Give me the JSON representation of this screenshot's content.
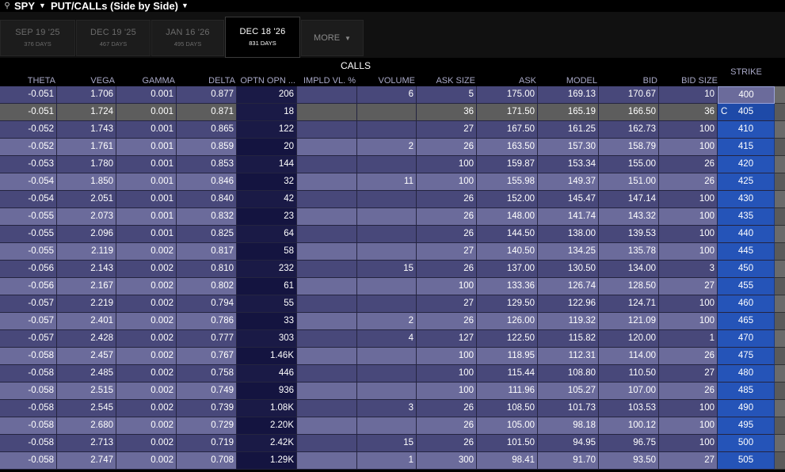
{
  "title_bar": {
    "symbol": "SPY",
    "view": "PUT/CALLs (Side by Side)"
  },
  "tabs": [
    {
      "label": "SEP 19 '25",
      "days": "376 DAYS",
      "active": false
    },
    {
      "label": "DEC 19 '25",
      "days": "467 DAYS",
      "active": false
    },
    {
      "label": "JAN 16 '26",
      "days": "495 DAYS",
      "active": false
    },
    {
      "label": "DEC 18 '26",
      "days": "831 DAYS",
      "active": true
    }
  ],
  "more_tab": {
    "label": "MORE"
  },
  "section_label": "CALLS",
  "strike_header": "STRIKE",
  "columns": [
    "THETA",
    "VEGA",
    "GAMMA",
    "DELTA",
    "OPTN OPN ...",
    "IMPLD VL. %",
    "VOLUME",
    "ASK SIZE",
    "ASK",
    "MODEL",
    "BID",
    "BID SIZE"
  ],
  "rows": [
    {
      "theta": "-0.051",
      "vega": "1.706",
      "gamma": "0.001",
      "delta": "0.877",
      "oi": "206",
      "iv": "",
      "volume": "6",
      "ask_size": "5",
      "ask": "175.00",
      "model": "169.13",
      "bid": "170.67",
      "bid_size": "10",
      "flag": "",
      "strike": "400"
    },
    {
      "theta": "-0.051",
      "vega": "1.724",
      "gamma": "0.001",
      "delta": "0.871",
      "oi": "18",
      "iv": "",
      "volume": "",
      "ask_size": "36",
      "ask": "171.50",
      "model": "165.19",
      "bid": "166.50",
      "bid_size": "36",
      "flag": "C",
      "strike": "405"
    },
    {
      "theta": "-0.052",
      "vega": "1.743",
      "gamma": "0.001",
      "delta": "0.865",
      "oi": "122",
      "iv": "",
      "volume": "",
      "ask_size": "27",
      "ask": "167.50",
      "model": "161.25",
      "bid": "162.73",
      "bid_size": "100",
      "flag": "",
      "strike": "410"
    },
    {
      "theta": "-0.052",
      "vega": "1.761",
      "gamma": "0.001",
      "delta": "0.859",
      "oi": "20",
      "iv": "",
      "volume": "2",
      "ask_size": "26",
      "ask": "163.50",
      "model": "157.30",
      "bid": "158.79",
      "bid_size": "100",
      "flag": "",
      "strike": "415"
    },
    {
      "theta": "-0.053",
      "vega": "1.780",
      "gamma": "0.001",
      "delta": "0.853",
      "oi": "144",
      "iv": "",
      "volume": "",
      "ask_size": "100",
      "ask": "159.87",
      "model": "153.34",
      "bid": "155.00",
      "bid_size": "26",
      "flag": "",
      "strike": "420"
    },
    {
      "theta": "-0.054",
      "vega": "1.850",
      "gamma": "0.001",
      "delta": "0.846",
      "oi": "32",
      "iv": "",
      "volume": "11",
      "ask_size": "100",
      "ask": "155.98",
      "model": "149.37",
      "bid": "151.00",
      "bid_size": "26",
      "flag": "",
      "strike": "425"
    },
    {
      "theta": "-0.054",
      "vega": "2.051",
      "gamma": "0.001",
      "delta": "0.840",
      "oi": "42",
      "iv": "",
      "volume": "",
      "ask_size": "26",
      "ask": "152.00",
      "model": "145.47",
      "bid": "147.14",
      "bid_size": "100",
      "flag": "",
      "strike": "430"
    },
    {
      "theta": "-0.055",
      "vega": "2.073",
      "gamma": "0.001",
      "delta": "0.832",
      "oi": "23",
      "iv": "",
      "volume": "",
      "ask_size": "26",
      "ask": "148.00",
      "model": "141.74",
      "bid": "143.32",
      "bid_size": "100",
      "flag": "",
      "strike": "435"
    },
    {
      "theta": "-0.055",
      "vega": "2.096",
      "gamma": "0.001",
      "delta": "0.825",
      "oi": "64",
      "iv": "",
      "volume": "",
      "ask_size": "26",
      "ask": "144.50",
      "model": "138.00",
      "bid": "139.53",
      "bid_size": "100",
      "flag": "",
      "strike": "440"
    },
    {
      "theta": "-0.055",
      "vega": "2.119",
      "gamma": "0.002",
      "delta": "0.817",
      "oi": "58",
      "iv": "",
      "volume": "",
      "ask_size": "27",
      "ask": "140.50",
      "model": "134.25",
      "bid": "135.78",
      "bid_size": "100",
      "flag": "",
      "strike": "445"
    },
    {
      "theta": "-0.056",
      "vega": "2.143",
      "gamma": "0.002",
      "delta": "0.810",
      "oi": "232",
      "iv": "",
      "volume": "15",
      "ask_size": "26",
      "ask": "137.00",
      "model": "130.50",
      "bid": "134.00",
      "bid_size": "3",
      "flag": "",
      "strike": "450"
    },
    {
      "theta": "-0.056",
      "vega": "2.167",
      "gamma": "0.002",
      "delta": "0.802",
      "oi": "61",
      "iv": "",
      "volume": "",
      "ask_size": "100",
      "ask": "133.36",
      "model": "126.74",
      "bid": "128.50",
      "bid_size": "27",
      "flag": "",
      "strike": "455"
    },
    {
      "theta": "-0.057",
      "vega": "2.219",
      "gamma": "0.002",
      "delta": "0.794",
      "oi": "55",
      "iv": "",
      "volume": "",
      "ask_size": "27",
      "ask": "129.50",
      "model": "122.96",
      "bid": "124.71",
      "bid_size": "100",
      "flag": "",
      "strike": "460"
    },
    {
      "theta": "-0.057",
      "vega": "2.401",
      "gamma": "0.002",
      "delta": "0.786",
      "oi": "33",
      "iv": "",
      "volume": "2",
      "ask_size": "26",
      "ask": "126.00",
      "model": "119.32",
      "bid": "121.09",
      "bid_size": "100",
      "flag": "",
      "strike": "465"
    },
    {
      "theta": "-0.057",
      "vega": "2.428",
      "gamma": "0.002",
      "delta": "0.777",
      "oi": "303",
      "iv": "",
      "volume": "4",
      "ask_size": "127",
      "ask": "122.50",
      "model": "115.82",
      "bid": "120.00",
      "bid_size": "1",
      "flag": "",
      "strike": "470"
    },
    {
      "theta": "-0.058",
      "vega": "2.457",
      "gamma": "0.002",
      "delta": "0.767",
      "oi": "1.46K",
      "iv": "",
      "volume": "",
      "ask_size": "100",
      "ask": "118.95",
      "model": "112.31",
      "bid": "114.00",
      "bid_size": "26",
      "flag": "",
      "strike": "475"
    },
    {
      "theta": "-0.058",
      "vega": "2.485",
      "gamma": "0.002",
      "delta": "0.758",
      "oi": "446",
      "iv": "",
      "volume": "",
      "ask_size": "100",
      "ask": "115.44",
      "model": "108.80",
      "bid": "110.50",
      "bid_size": "27",
      "flag": "",
      "strike": "480"
    },
    {
      "theta": "-0.058",
      "vega": "2.515",
      "gamma": "0.002",
      "delta": "0.749",
      "oi": "936",
      "iv": "",
      "volume": "",
      "ask_size": "100",
      "ask": "111.96",
      "model": "105.27",
      "bid": "107.00",
      "bid_size": "26",
      "flag": "",
      "strike": "485"
    },
    {
      "theta": "-0.058",
      "vega": "2.545",
      "gamma": "0.002",
      "delta": "0.739",
      "oi": "1.08K",
      "iv": "",
      "volume": "3",
      "ask_size": "26",
      "ask": "108.50",
      "model": "101.73",
      "bid": "103.53",
      "bid_size": "100",
      "flag": "",
      "strike": "490"
    },
    {
      "theta": "-0.058",
      "vega": "2.680",
      "gamma": "0.002",
      "delta": "0.729",
      "oi": "2.20K",
      "iv": "",
      "volume": "",
      "ask_size": "26",
      "ask": "105.00",
      "model": "98.18",
      "bid": "100.12",
      "bid_size": "100",
      "flag": "",
      "strike": "495"
    },
    {
      "theta": "-0.058",
      "vega": "2.713",
      "gamma": "0.002",
      "delta": "0.719",
      "oi": "2.42K",
      "iv": "",
      "volume": "15",
      "ask_size": "26",
      "ask": "101.50",
      "model": "94.95",
      "bid": "96.75",
      "bid_size": "100",
      "flag": "",
      "strike": "500"
    },
    {
      "theta": "-0.058",
      "vega": "2.747",
      "gamma": "0.002",
      "delta": "0.708",
      "oi": "1.29K",
      "iv": "",
      "volume": "1",
      "ask_size": "300",
      "ask": "98.41",
      "model": "91.70",
      "bid": "93.50",
      "bid_size": "27",
      "flag": "",
      "strike": "505"
    }
  ]
}
